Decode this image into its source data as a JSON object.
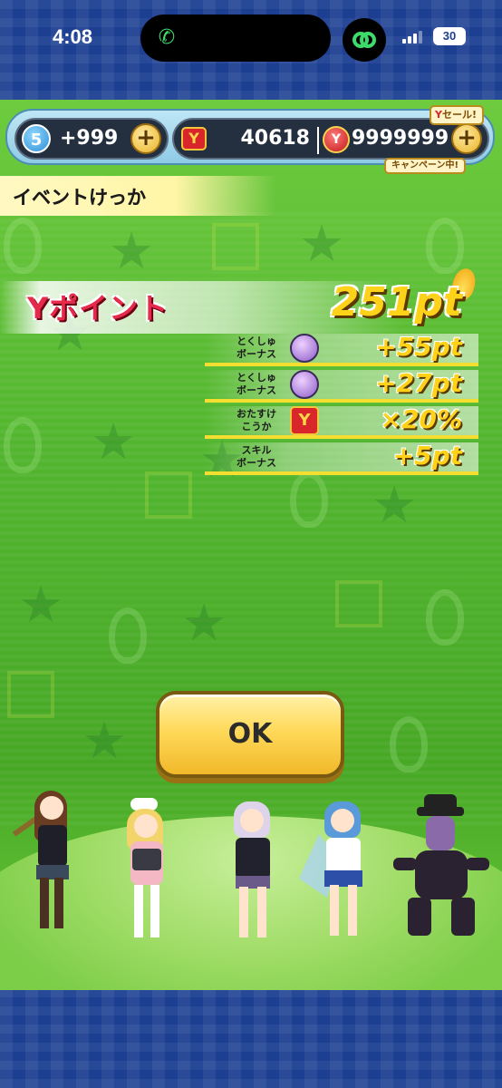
{
  "status_bar": {
    "time": "4:08",
    "battery": "30"
  },
  "hud": {
    "stamina_level": "5",
    "stamina_value": "+999",
    "ymoney_value": "40618",
    "coin_value": "9999999",
    "sale_tag": "セール!",
    "campaign_tag": "キャンペーン中!"
  },
  "title": "イベントけっか",
  "points": {
    "label": "Yポイント",
    "total": "251pt",
    "bonuses": [
      {
        "label": "とくしゅ\nボーナス",
        "value": "+55pt",
        "icon": "purple-cat-medal-icon"
      },
      {
        "label": "とくしゅ\nボーナス",
        "value": "+27pt",
        "icon": "purple-hat-medal-icon"
      },
      {
        "label": "おたすけ\nこうか",
        "value": "×20%",
        "icon": "ymoney-up-icon"
      },
      {
        "label": "スキル\nボーナス",
        "value": "+5pt",
        "icon": ""
      }
    ]
  },
  "ok_button": "OK",
  "colors": {
    "accent_yellow": "#ffd21a",
    "ypoint_red": "#e62a4a",
    "frame_blue": "#1d3f92",
    "field_green": "#52b52f"
  }
}
